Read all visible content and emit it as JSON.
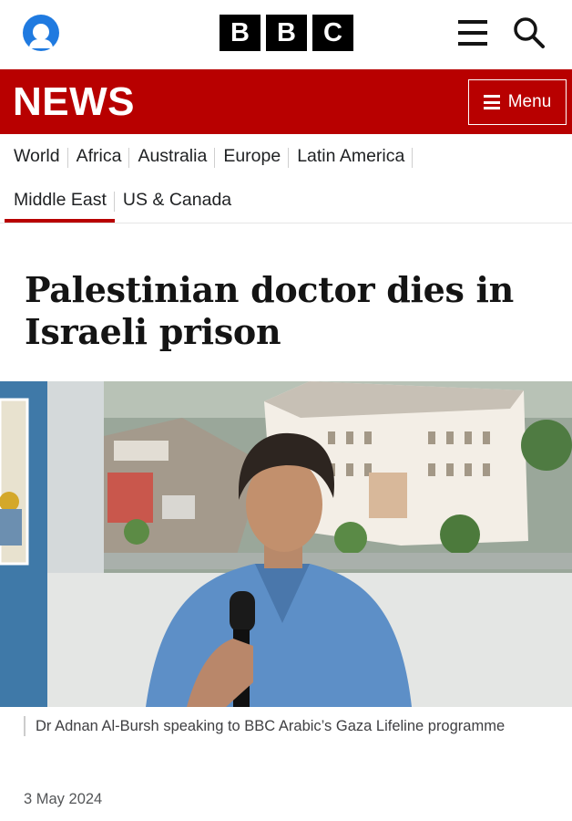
{
  "header": {
    "account_icon": "account-icon",
    "logo_letters": [
      "B",
      "B",
      "C"
    ],
    "menu_icon": "hamburger-icon",
    "search_icon": "search-icon"
  },
  "news_bar": {
    "title": "NEWS",
    "menu_label": "Menu",
    "brand_color": "#b80000"
  },
  "nav": {
    "row1": [
      "World",
      "Africa",
      "Australia",
      "Europe",
      "Latin America"
    ],
    "row2": [
      "Middle East",
      "US & Canada"
    ],
    "active": "Middle East"
  },
  "article": {
    "headline": "Palestinian doctor dies in Israeli prison",
    "caption": "Dr Adnan Al-Bursh speaking to BBC Arabic’s Gaza Lifeline programme",
    "date": "3 May 2024"
  }
}
